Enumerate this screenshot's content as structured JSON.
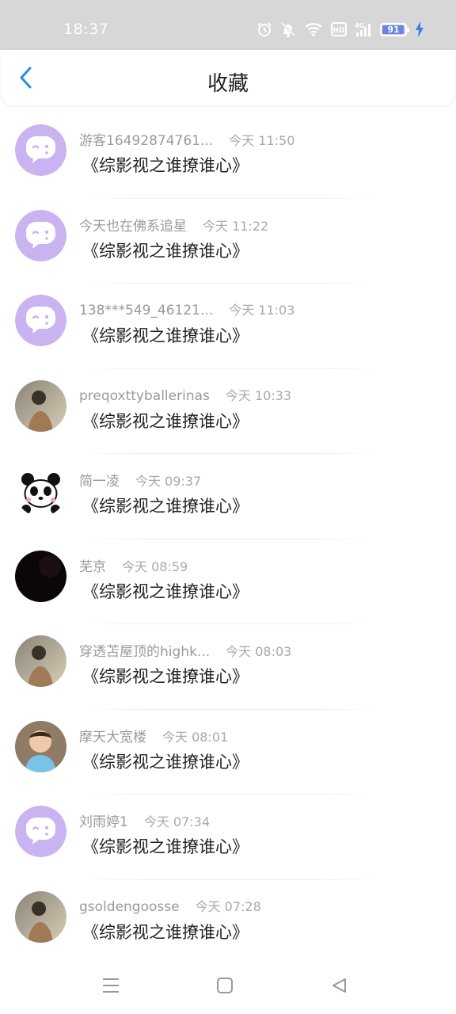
{
  "status": {
    "time": "18:37",
    "battery": "91",
    "battery_level": 0.91,
    "icons": [
      "alarm-icon",
      "mute-icon",
      "wifi-icon",
      "hd-icon",
      "4g-signal-icon",
      "battery-icon",
      "charging-icon"
    ]
  },
  "header": {
    "title": "收藏",
    "back_icon": "chevron-left-icon"
  },
  "items": [
    {
      "username": "游客16492874761...",
      "time": "今天 11:50",
      "content": "《综影视之谁撩谁心》",
      "avatar": "default-chat-avatar"
    },
    {
      "username": "今天也在佛系追星",
      "time": "今天 11:22",
      "content": "《综影视之谁撩谁心》",
      "avatar": "default-chat-avatar"
    },
    {
      "username": "138***549_46121...",
      "time": "今天 11:03",
      "content": "《综影视之谁撩谁心》",
      "avatar": "default-chat-avatar"
    },
    {
      "username": "preqoxttyballerinas",
      "time": "今天 10:33",
      "content": "《综影视之谁撩谁心》",
      "avatar": "photo-avatar"
    },
    {
      "username": "简一凌",
      "time": "今天 09:37",
      "content": "《综影视之谁撩谁心》",
      "avatar": "panda-avatar"
    },
    {
      "username": "芜京",
      "time": "今天 08:59",
      "content": "《综影视之谁撩谁心》",
      "avatar": "dark-avatar"
    },
    {
      "username": "穿透苫屋顶的highk...",
      "time": "今天 08:03",
      "content": "《综影视之谁撩谁心》",
      "avatar": "photo-avatar"
    },
    {
      "username": "摩天大宽楼",
      "time": "今天 08:01",
      "content": "《综影视之谁撩谁心》",
      "avatar": "child-photo-avatar"
    },
    {
      "username": "刘雨婷1",
      "time": "今天 07:34",
      "content": "《综影视之谁撩谁心》",
      "avatar": "default-chat-avatar"
    },
    {
      "username": "gsoldengoosse",
      "time": "今天 07:28",
      "content": "《综影视之谁撩谁心》",
      "avatar": "photo-avatar"
    }
  ],
  "nav": [
    "menu-icon",
    "home-square-icon",
    "back-triangle-icon"
  ],
  "colors": {
    "status_bar": "#d7d7d7",
    "accent": "#2a8cdc",
    "avatar_default": "#c9b3f0",
    "battery_fill": "#6b83e6"
  }
}
